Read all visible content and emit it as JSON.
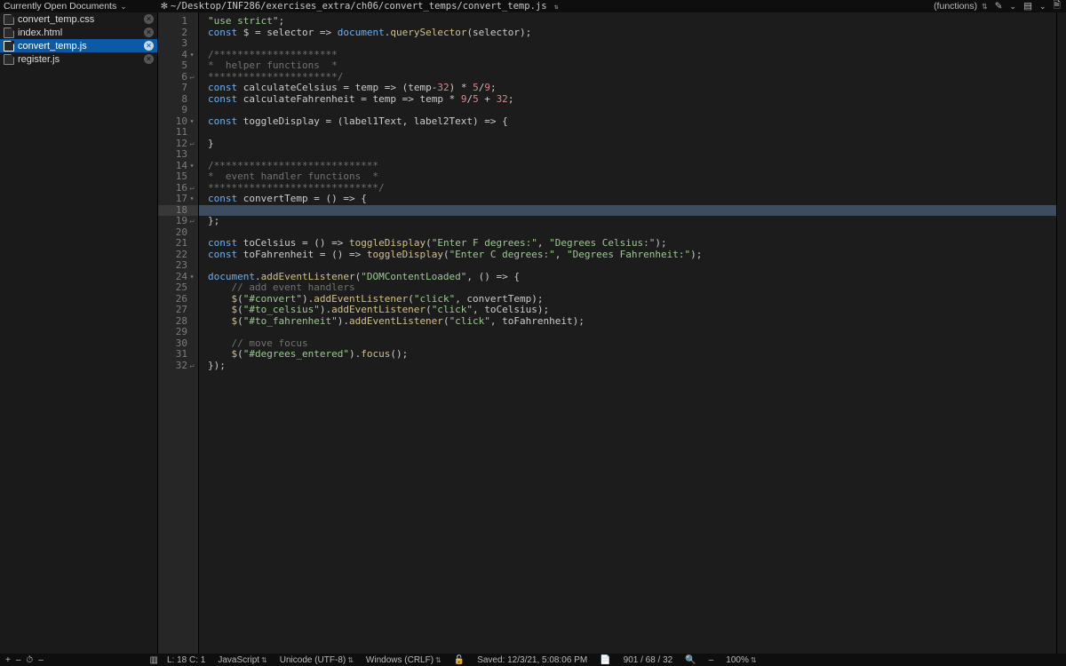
{
  "topbar": {
    "left_label": "Currently Open Documents",
    "settings_icon": "gear-icon",
    "path": "~/Desktop/INF286/exercises_extra/ch06/convert_temps/convert_temp.js",
    "functions_label": "(functions)"
  },
  "sidebar": {
    "documents": [
      {
        "name": "convert_temp.css",
        "active": false
      },
      {
        "name": "index.html",
        "active": false
      },
      {
        "name": "convert_temp.js",
        "active": true
      },
      {
        "name": "register.js",
        "active": false
      }
    ]
  },
  "editor": {
    "current_line": 18,
    "lines": [
      {
        "n": 1,
        "fold": "",
        "ret": "",
        "tokens": [
          {
            "t": "str",
            "s": "\"use strict\""
          },
          {
            "t": "op",
            "s": ";"
          }
        ]
      },
      {
        "n": 2,
        "fold": "",
        "ret": "",
        "tokens": [
          {
            "t": "kw",
            "s": "const"
          },
          {
            "t": "op",
            "s": " $ "
          },
          {
            "t": "op",
            "s": "="
          },
          {
            "t": "op",
            "s": " selector "
          },
          {
            "t": "op",
            "s": "=> "
          },
          {
            "t": "kw",
            "s": "document"
          },
          {
            "t": "op",
            "s": "."
          },
          {
            "t": "fn",
            "s": "querySelector"
          },
          {
            "t": "op",
            "s": "(selector);"
          }
        ]
      },
      {
        "n": 3,
        "fold": "",
        "ret": "",
        "tokens": []
      },
      {
        "n": 4,
        "fold": "▾",
        "ret": "",
        "tokens": [
          {
            "t": "cm",
            "s": "/*********************"
          }
        ]
      },
      {
        "n": 5,
        "fold": "",
        "ret": "",
        "tokens": [
          {
            "t": "cm",
            "s": "*  helper functions  *"
          }
        ]
      },
      {
        "n": 6,
        "fold": "",
        "ret": "↵",
        "tokens": [
          {
            "t": "cm",
            "s": "**********************/"
          }
        ]
      },
      {
        "n": 7,
        "fold": "",
        "ret": "",
        "tokens": [
          {
            "t": "kw",
            "s": "const"
          },
          {
            "t": "op",
            "s": " calculateCelsius "
          },
          {
            "t": "op",
            "s": "="
          },
          {
            "t": "op",
            "s": " temp "
          },
          {
            "t": "op",
            "s": "=> "
          },
          {
            "t": "op",
            "s": "(temp"
          },
          {
            "t": "op",
            "s": "-"
          },
          {
            "t": "num-lit",
            "s": "32"
          },
          {
            "t": "op",
            "s": ") * "
          },
          {
            "t": "num-lit",
            "s": "5"
          },
          {
            "t": "op",
            "s": "/"
          },
          {
            "t": "num-lit",
            "s": "9"
          },
          {
            "t": "op",
            "s": ";"
          }
        ]
      },
      {
        "n": 8,
        "fold": "",
        "ret": "",
        "tokens": [
          {
            "t": "kw",
            "s": "const"
          },
          {
            "t": "op",
            "s": " calculateFahrenheit "
          },
          {
            "t": "op",
            "s": "="
          },
          {
            "t": "op",
            "s": " temp "
          },
          {
            "t": "op",
            "s": "=> "
          },
          {
            "t": "op",
            "s": "temp * "
          },
          {
            "t": "num-lit",
            "s": "9"
          },
          {
            "t": "op",
            "s": "/"
          },
          {
            "t": "num-lit",
            "s": "5"
          },
          {
            "t": "op",
            "s": " + "
          },
          {
            "t": "num-lit",
            "s": "32"
          },
          {
            "t": "op",
            "s": ";"
          }
        ]
      },
      {
        "n": 9,
        "fold": "",
        "ret": "",
        "tokens": []
      },
      {
        "n": 10,
        "fold": "▾",
        "ret": "",
        "tokens": [
          {
            "t": "kw",
            "s": "const"
          },
          {
            "t": "op",
            "s": " toggleDisplay "
          },
          {
            "t": "op",
            "s": "="
          },
          {
            "t": "op",
            "s": " (label1Text, label2Text) "
          },
          {
            "t": "op",
            "s": "=> "
          },
          {
            "t": "op",
            "s": "{"
          }
        ]
      },
      {
        "n": 11,
        "fold": "",
        "ret": "",
        "tokens": []
      },
      {
        "n": 12,
        "fold": "",
        "ret": "↵",
        "tokens": [
          {
            "t": "op",
            "s": "}"
          }
        ]
      },
      {
        "n": 13,
        "fold": "",
        "ret": "",
        "tokens": []
      },
      {
        "n": 14,
        "fold": "▾",
        "ret": "",
        "tokens": [
          {
            "t": "cm",
            "s": "/****************************"
          }
        ]
      },
      {
        "n": 15,
        "fold": "",
        "ret": "",
        "tokens": [
          {
            "t": "cm",
            "s": "*  event handler functions  *"
          }
        ]
      },
      {
        "n": 16,
        "fold": "",
        "ret": "↵",
        "tokens": [
          {
            "t": "cm",
            "s": "*****************************/"
          }
        ]
      },
      {
        "n": 17,
        "fold": "▾",
        "ret": "",
        "tokens": [
          {
            "t": "kw",
            "s": "const"
          },
          {
            "t": "op",
            "s": " convertTemp "
          },
          {
            "t": "op",
            "s": "="
          },
          {
            "t": "op",
            "s": " () "
          },
          {
            "t": "op",
            "s": "=> "
          },
          {
            "t": "op",
            "s": "{"
          }
        ]
      },
      {
        "n": 18,
        "fold": "",
        "ret": "",
        "tokens": []
      },
      {
        "n": 19,
        "fold": "",
        "ret": "↵",
        "tokens": [
          {
            "t": "op",
            "s": "};"
          }
        ]
      },
      {
        "n": 20,
        "fold": "",
        "ret": "",
        "tokens": []
      },
      {
        "n": 21,
        "fold": "",
        "ret": "",
        "tokens": [
          {
            "t": "kw",
            "s": "const"
          },
          {
            "t": "op",
            "s": " toCelsius "
          },
          {
            "t": "op",
            "s": "="
          },
          {
            "t": "op",
            "s": " () "
          },
          {
            "t": "op",
            "s": "=> "
          },
          {
            "t": "fn",
            "s": "toggleDisplay"
          },
          {
            "t": "op",
            "s": "("
          },
          {
            "t": "str",
            "s": "\"Enter F degrees:\""
          },
          {
            "t": "op",
            "s": ", "
          },
          {
            "t": "str",
            "s": "\"Degrees Celsius:\""
          },
          {
            "t": "op",
            "s": ");"
          }
        ]
      },
      {
        "n": 22,
        "fold": "",
        "ret": "",
        "tokens": [
          {
            "t": "kw",
            "s": "const"
          },
          {
            "t": "op",
            "s": " toFahrenheit "
          },
          {
            "t": "op",
            "s": "="
          },
          {
            "t": "op",
            "s": " () "
          },
          {
            "t": "op",
            "s": "=> "
          },
          {
            "t": "fn",
            "s": "toggleDisplay"
          },
          {
            "t": "op",
            "s": "("
          },
          {
            "t": "str",
            "s": "\"Enter C degrees:\""
          },
          {
            "t": "op",
            "s": ", "
          },
          {
            "t": "str",
            "s": "\"Degrees Fahrenheit:\""
          },
          {
            "t": "op",
            "s": ");"
          }
        ]
      },
      {
        "n": 23,
        "fold": "",
        "ret": "",
        "tokens": []
      },
      {
        "n": 24,
        "fold": "▾",
        "ret": "",
        "tokens": [
          {
            "t": "kw",
            "s": "document"
          },
          {
            "t": "op",
            "s": "."
          },
          {
            "t": "fn",
            "s": "addEventListener"
          },
          {
            "t": "op",
            "s": "("
          },
          {
            "t": "str",
            "s": "\"DOMContentLoaded\""
          },
          {
            "t": "op",
            "s": ", () "
          },
          {
            "t": "op",
            "s": "=> "
          },
          {
            "t": "op",
            "s": "{"
          }
        ]
      },
      {
        "n": 25,
        "fold": "",
        "ret": "",
        "tokens": [
          {
            "t": "op",
            "s": "    "
          },
          {
            "t": "cm",
            "s": "// add event handlers"
          }
        ]
      },
      {
        "n": 26,
        "fold": "",
        "ret": "",
        "tokens": [
          {
            "t": "op",
            "s": "    "
          },
          {
            "t": "fn",
            "s": "$"
          },
          {
            "t": "op",
            "s": "("
          },
          {
            "t": "str",
            "s": "\"#convert\""
          },
          {
            "t": "op",
            "s": ")."
          },
          {
            "t": "fn",
            "s": "addEventListener"
          },
          {
            "t": "op",
            "s": "("
          },
          {
            "t": "str",
            "s": "\"click\""
          },
          {
            "t": "op",
            "s": ", convertTemp);"
          }
        ]
      },
      {
        "n": 27,
        "fold": "",
        "ret": "",
        "tokens": [
          {
            "t": "op",
            "s": "    "
          },
          {
            "t": "fn",
            "s": "$"
          },
          {
            "t": "op",
            "s": "("
          },
          {
            "t": "str",
            "s": "\"#to_celsius\""
          },
          {
            "t": "op",
            "s": ")."
          },
          {
            "t": "fn",
            "s": "addEventListener"
          },
          {
            "t": "op",
            "s": "("
          },
          {
            "t": "str",
            "s": "\"click\""
          },
          {
            "t": "op",
            "s": ", toCelsius);"
          }
        ]
      },
      {
        "n": 28,
        "fold": "",
        "ret": "",
        "tokens": [
          {
            "t": "op",
            "s": "    "
          },
          {
            "t": "fn",
            "s": "$"
          },
          {
            "t": "op",
            "s": "("
          },
          {
            "t": "str",
            "s": "\"#to_fahrenheit\""
          },
          {
            "t": "op",
            "s": ")."
          },
          {
            "t": "fn",
            "s": "addEventListener"
          },
          {
            "t": "op",
            "s": "("
          },
          {
            "t": "str",
            "s": "\"click\""
          },
          {
            "t": "op",
            "s": ", toFahrenheit);"
          }
        ]
      },
      {
        "n": 29,
        "fold": "",
        "ret": "",
        "tokens": []
      },
      {
        "n": 30,
        "fold": "",
        "ret": "",
        "tokens": [
          {
            "t": "op",
            "s": "    "
          },
          {
            "t": "cm",
            "s": "// move focus"
          }
        ]
      },
      {
        "n": 31,
        "fold": "",
        "ret": "",
        "tokens": [
          {
            "t": "op",
            "s": "    "
          },
          {
            "t": "fn",
            "s": "$"
          },
          {
            "t": "op",
            "s": "("
          },
          {
            "t": "str",
            "s": "\"#degrees_entered\""
          },
          {
            "t": "op",
            "s": ")."
          },
          {
            "t": "fn",
            "s": "focus"
          },
          {
            "t": "op",
            "s": "();"
          }
        ]
      },
      {
        "n": 32,
        "fold": "",
        "ret": "↵",
        "tokens": [
          {
            "t": "op",
            "s": "});"
          }
        ]
      }
    ]
  },
  "statusbar": {
    "plus": "+",
    "minus": "–",
    "clock": "⏱",
    "view_icon": "▥",
    "cursor": "L: 18 C: 1",
    "language": "JavaScript",
    "encoding": "Unicode (UTF-8)",
    "line_endings": "Windows (CRLF)",
    "lock_icon": "🔓",
    "saved": "Saved: 12/3/21, 5:08:06 PM",
    "doc_icon": "📄",
    "counts": "901 / 68 / 32",
    "search_icon": "🔍",
    "search_minus": "–",
    "zoom": "100%"
  }
}
